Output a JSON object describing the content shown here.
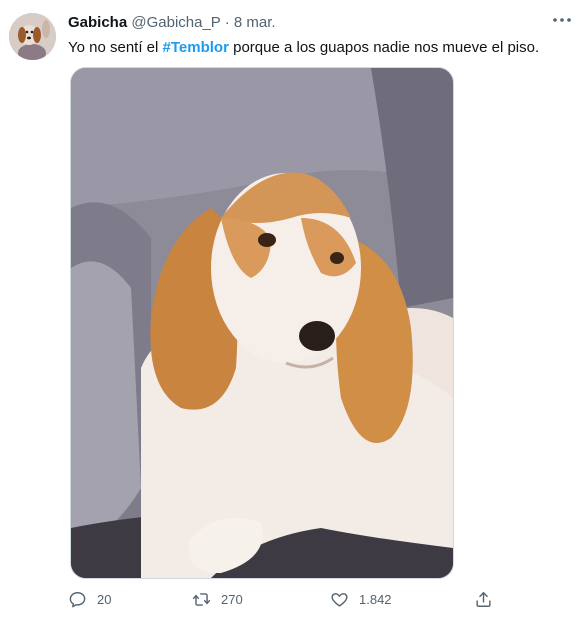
{
  "tweet": {
    "author_name": "Gabicha",
    "handle": "@Gabicha_P",
    "separator": "·",
    "date": "8 mar.",
    "text_before": "Yo no sentí el ",
    "hashtag": "#Temblor",
    "text_after": " porque a los guapos nadie nos mueve el piso."
  },
  "actions": {
    "replies": "20",
    "retweets": "270",
    "likes": "1.842"
  },
  "icons": {
    "reply": "reply-icon",
    "retweet": "retweet-icon",
    "like": "heart-icon",
    "share": "share-icon",
    "more": "more-options-icon"
  },
  "colors": {
    "link": "#1d9bf0",
    "secondary_text": "#536471"
  }
}
